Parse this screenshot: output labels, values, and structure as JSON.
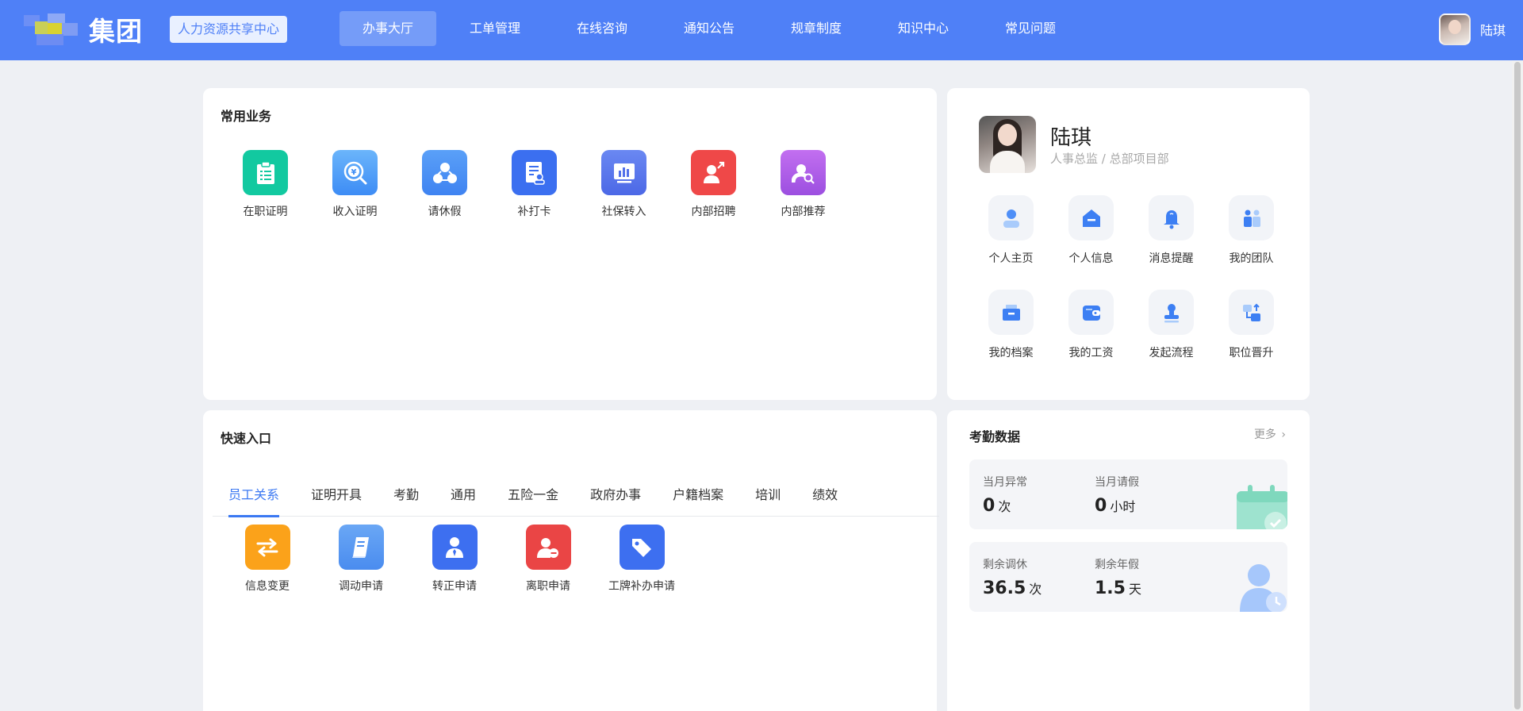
{
  "header": {
    "brand": "集团",
    "tag": "人力资源共享中心",
    "nav": [
      "办事大厅",
      "工单管理",
      "在线咨询",
      "通知公告",
      "规章制度",
      "知识中心",
      "常见问题"
    ],
    "active_nav": 0,
    "user_name": "陆琪",
    "color": "#4f80f7"
  },
  "common_business": {
    "title": "常用业务",
    "items": [
      {
        "label": "在职证明",
        "icon": "clipboard-icon",
        "color": "#12c9a0"
      },
      {
        "label": "收入证明",
        "icon": "yen-coin-icon",
        "color": "#4d9cf8"
      },
      {
        "label": "请休假",
        "icon": "people-group-icon",
        "color": "#4d8ff7"
      },
      {
        "label": "补打卡",
        "icon": "document-user-icon",
        "color": "#3b6ff0"
      },
      {
        "label": "社保转入",
        "icon": "bar-chart-icon",
        "color": "#5b77ec"
      },
      {
        "label": "内部招聘",
        "icon": "user-arrow-icon",
        "color": "#ef4848"
      },
      {
        "label": "内部推荐",
        "icon": "user-search-icon",
        "color": "#b35ce8"
      }
    ]
  },
  "profile": {
    "name": "陆琪",
    "role": "人事总监 / 总部项目部",
    "links": [
      {
        "label": "个人主页",
        "icon": "person-icon"
      },
      {
        "label": "个人信息",
        "icon": "home-info-icon"
      },
      {
        "label": "消息提醒",
        "icon": "bell-icon"
      },
      {
        "label": "我的团队",
        "icon": "team-icon"
      },
      {
        "label": "我的档案",
        "icon": "archive-icon"
      },
      {
        "label": "我的工资",
        "icon": "wallet-icon"
      },
      {
        "label": "发起流程",
        "icon": "stamp-icon"
      },
      {
        "label": "职位晋升",
        "icon": "promotion-icon"
      }
    ]
  },
  "quick_entry": {
    "title": "快速入口",
    "tabs": [
      "员工关系",
      "证明开具",
      "考勤",
      "通用",
      "五险一金",
      "政府办事",
      "户籍档案",
      "培训",
      "绩效"
    ],
    "active_tab": 0,
    "items": [
      {
        "label": "信息变更",
        "icon": "swap-arrows-icon",
        "color": "#fba21a"
      },
      {
        "label": "调动申请",
        "icon": "book-icon",
        "color": "#5a9af2"
      },
      {
        "label": "转正申请",
        "icon": "user-tie-icon",
        "color": "#3d6ff0"
      },
      {
        "label": "离职申请",
        "icon": "user-remove-icon",
        "color": "#ea4545"
      },
      {
        "label": "工牌补办申请",
        "icon": "tag-icon",
        "color": "#3d6ff0"
      }
    ]
  },
  "attendance": {
    "title": "考勤数据",
    "more": "更多",
    "boxes": [
      {
        "icon": "calendar-check-icon",
        "stats": [
          {
            "label": "当月异常",
            "value": "0",
            "unit": "次"
          },
          {
            "label": "当月请假",
            "value": "0",
            "unit": "小时"
          }
        ]
      },
      {
        "icon": "person-clock-icon",
        "stats": [
          {
            "label": "剩余调休",
            "value": "36.5",
            "unit": "次"
          },
          {
            "label": "剩余年假",
            "value": "1.5",
            "unit": "天"
          }
        ]
      }
    ]
  }
}
